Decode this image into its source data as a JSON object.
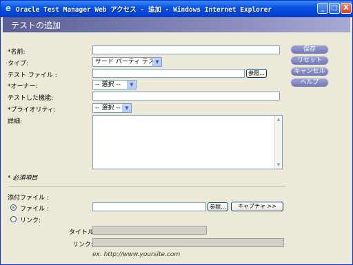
{
  "window": {
    "title": "Oracle Test Manager Web アクセス - 追加 - Windows Internet Explorer",
    "min_label": "_",
    "max_label": "□",
    "close_label": "X"
  },
  "header": {
    "title": "テストの追加"
  },
  "form": {
    "name_label": "*名前:",
    "name_value": "",
    "type_label": "タイプ:",
    "type_value": "サード パーティ テスト",
    "test_file_label": "テスト ファイル :",
    "browse_label": "参照...",
    "owner_label": "*オーナー:",
    "owner_value": "-- 選択 --",
    "tested_feature_label": "テストした機能:",
    "priority_label": "*プライオリティ:",
    "priority_value": "-- 選択 --",
    "details_label": "詳細:",
    "required_note": "* 必須項目"
  },
  "side_buttons": {
    "save": "保存",
    "reset": "リセット",
    "cancel": "キャンセル",
    "help": "ヘルプ"
  },
  "attachment": {
    "label": "添付ファイル :",
    "file_option": "ファイル :",
    "link_option": "リンク:",
    "browse_label": "参照...",
    "capture_label": "キャプチャ >>",
    "title_label": "タイトル:",
    "link_label": "リンク:",
    "example": "ex. http://www.yoursite.com",
    "selected": "file"
  },
  "colors": {
    "titlebar": "#0a54e3",
    "header": "#6a6fa8",
    "side_button": "#8a8fc4"
  }
}
